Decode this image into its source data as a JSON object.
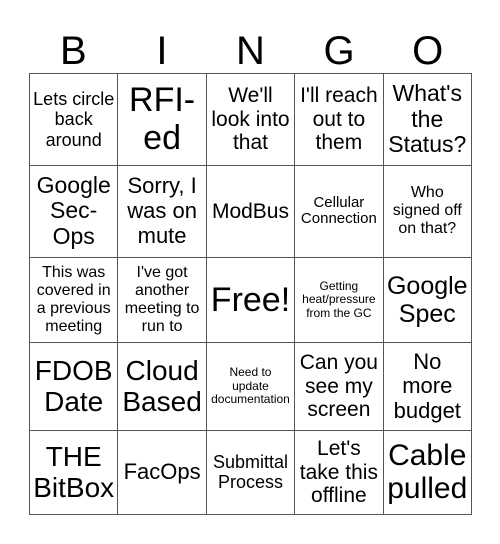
{
  "header": [
    "B",
    "I",
    "N",
    "G",
    "O"
  ],
  "rows": [
    [
      "Lets circle\nback\naround",
      "RFI-\ned",
      "We'll\nlook into\nthat",
      "I'll reach\nout to\nthem",
      "What's\nthe\nStatus?"
    ],
    [
      "Google\nSec-\nOps",
      "Sorry, I\nwas on\nmute",
      "ModBus",
      "Cellular\nConnection",
      "Who\nsigned off\non that?"
    ],
    [
      "This was\ncovered in\na previous\nmeeting",
      "I've got\nanother\nmeeting to\nrun to",
      "Free!",
      "Getting\nheat/pressure\nfrom the GC",
      "Google\nSpec"
    ],
    [
      "FDOB\nDate",
      "Cloud\nBased",
      "Need to\nupdate\ndocumentation",
      "Can you\nsee my\nscreen",
      "No\nmore\nbudget"
    ],
    [
      "THE\nBitBox",
      "FacOps",
      "Submittal\nProcess",
      "Let's\ntake this\noffline",
      "Cable\npulled"
    ]
  ]
}
